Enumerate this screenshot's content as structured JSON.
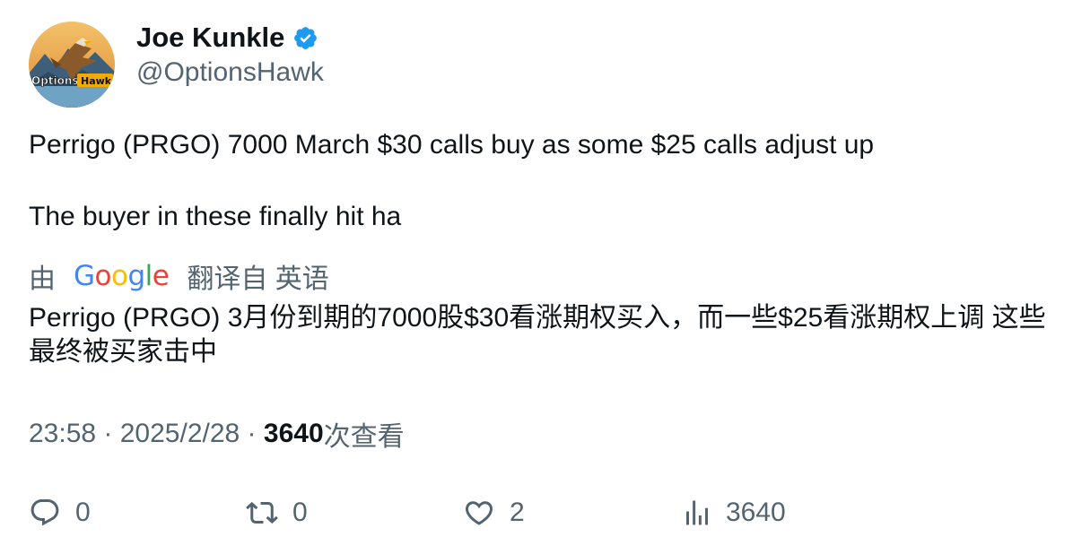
{
  "author": {
    "display_name": "Joe Kunkle",
    "handle": "@OptionsHawk",
    "verified": true,
    "avatar_text": "OptionsHawk"
  },
  "tweet": {
    "paragraphs": [
      "Perrigo (PRGO) 7000 March $30 calls buy as some $25 calls adjust up",
      "The buyer in these finally hit ha"
    ]
  },
  "translation": {
    "prefix": "由",
    "provider": "Google",
    "suffix": "翻译自 英语",
    "text": "Perrigo (PRGO) 3月份到期的7000股$30看涨期权买入，而一些$25看涨期权上调 这些最终被买家击中"
  },
  "meta": {
    "time": "23:58",
    "separator": " · ",
    "date": "2025/2/28",
    "views_count": "3640",
    "views_label": "次查看"
  },
  "actions": {
    "reply_count": "0",
    "retweet_count": "0",
    "like_count": "2",
    "views_count": "3640"
  },
  "colors": {
    "text_primary": "#0f1419",
    "text_secondary": "#536471",
    "verified_blue": "#1d9bf0",
    "google_blue": "#4285F4",
    "google_red": "#EA4335",
    "google_yellow": "#FBBC05",
    "google_green": "#34A853"
  },
  "icons": {
    "verified": "verified-badge-icon",
    "reply": "reply-icon",
    "retweet": "retweet-icon",
    "like": "heart-icon",
    "views": "views-bar-chart-icon"
  }
}
